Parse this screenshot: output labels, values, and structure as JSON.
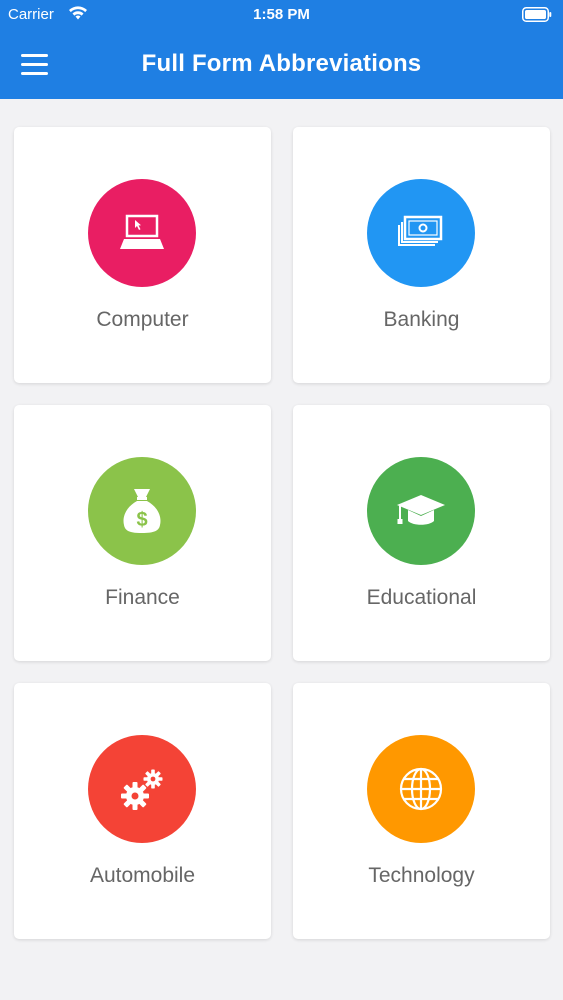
{
  "status_bar": {
    "carrier": "Carrier",
    "time": "1:58 PM"
  },
  "header": {
    "title": "Full Form Abbreviations",
    "menu_icon": "hamburger-icon",
    "background_color": "#1f7fe3"
  },
  "categories": [
    {
      "label": "Computer",
      "icon": "laptop-icon",
      "color": "#e91e63"
    },
    {
      "label": "Banking",
      "icon": "cash-stack-icon",
      "color": "#2196f3"
    },
    {
      "label": "Finance",
      "icon": "money-bag-icon",
      "color": "#8bc34a"
    },
    {
      "label": "Educational",
      "icon": "graduation-cap-icon",
      "color": "#4caf50"
    },
    {
      "label": "Automobile",
      "icon": "gears-icon",
      "color": "#f44336"
    },
    {
      "label": "Technology",
      "icon": "globe-icon",
      "color": "#ff9800"
    }
  ]
}
